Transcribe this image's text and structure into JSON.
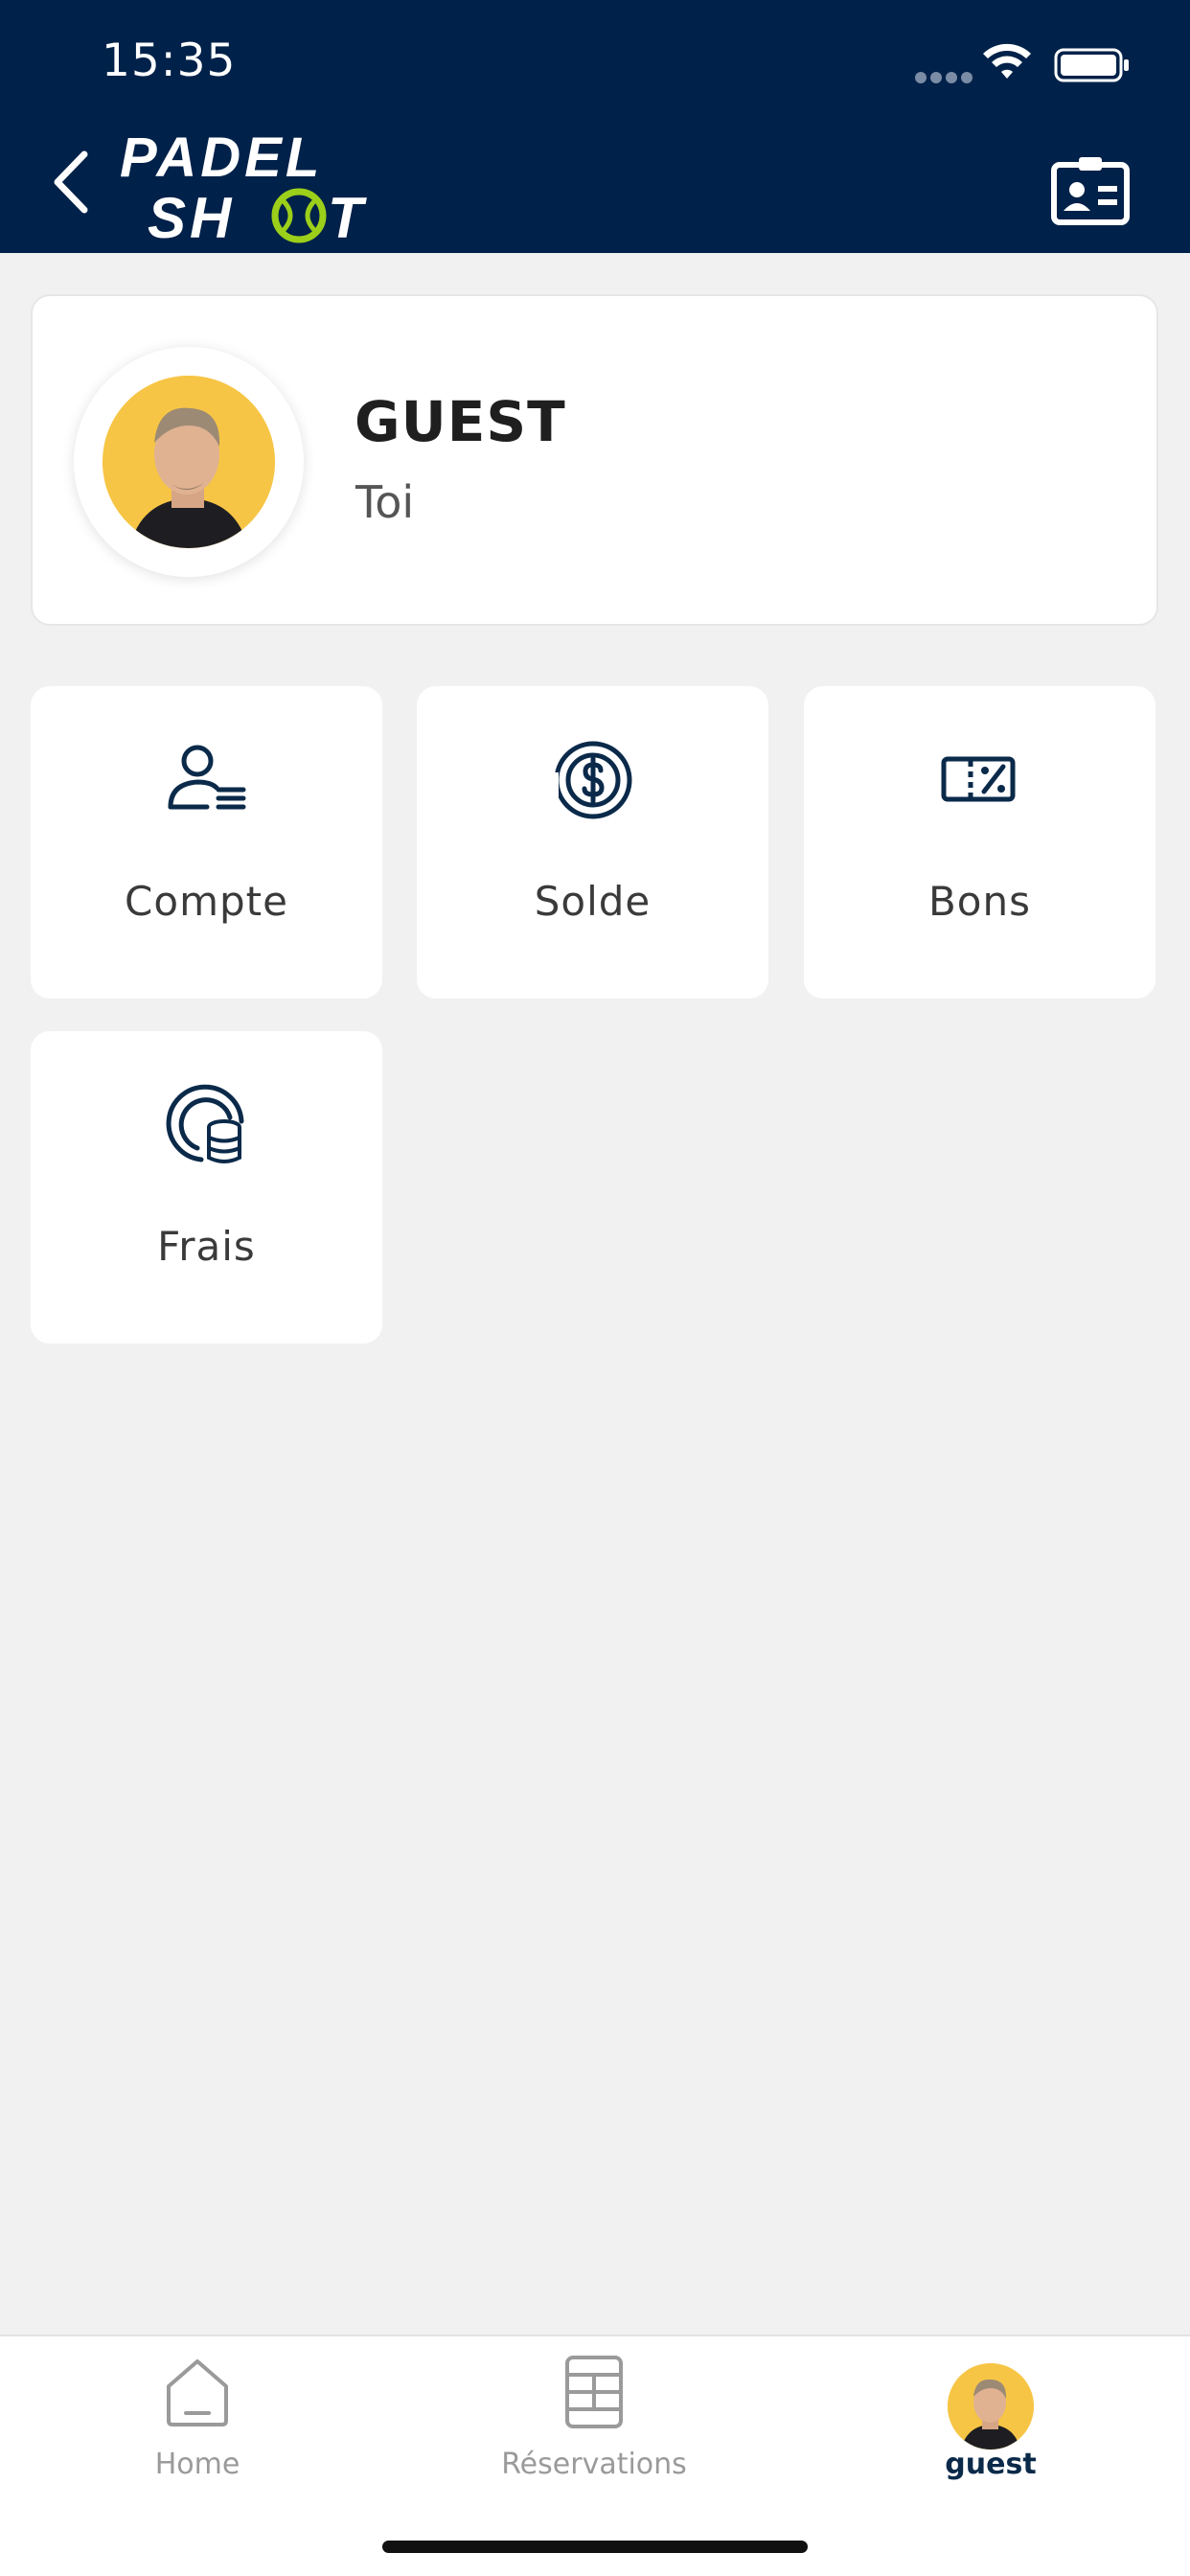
{
  "status_bar": {
    "time": "15:35",
    "signal_icon": "cellular-dots-icon",
    "wifi_icon": "wifi-icon",
    "battery_icon": "battery-icon"
  },
  "header": {
    "back_icon": "chevron-left-icon",
    "logo_text_top": "PADEL",
    "logo_text_bottom_left": "SH",
    "logo_text_bottom_right": "T",
    "card_icon": "id-card-icon",
    "background": "#002149",
    "accent": "#9ccf1a"
  },
  "profile": {
    "name": "GUEST",
    "subtitle": "Toi"
  },
  "tiles": [
    {
      "label": "Compte",
      "icon": "user-list-icon"
    },
    {
      "label": "Solde",
      "icon": "dollar-coin-icon"
    },
    {
      "label": "Bons",
      "icon": "discount-voucher-icon"
    },
    {
      "label": "Frais",
      "icon": "coins-stack-icon"
    }
  ],
  "bottom_nav": {
    "items": [
      {
        "label": "Home",
        "icon": "home-icon"
      },
      {
        "label": "Réservations",
        "icon": "court-icon"
      },
      {
        "label": "guest",
        "icon": "avatar"
      }
    ],
    "active": "guest"
  }
}
